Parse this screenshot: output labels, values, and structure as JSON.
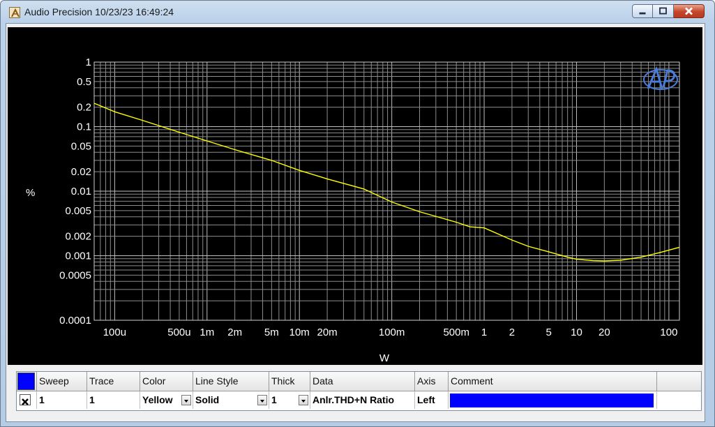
{
  "window": {
    "title": "Audio Precision  10/23/23 16:49:24"
  },
  "chart_data": {
    "type": "line",
    "xscale": "log",
    "yscale": "log",
    "xlabel": "W",
    "ylabel": "%",
    "xlim": [
      6e-05,
      130
    ],
    "ylim": [
      0.0001,
      1
    ],
    "x_ticks": [
      {
        "v": 0.0001,
        "label": "100u"
      },
      {
        "v": 0.0005,
        "label": "500u"
      },
      {
        "v": 0.001,
        "label": "1m"
      },
      {
        "v": 0.002,
        "label": "2m"
      },
      {
        "v": 0.005,
        "label": "5m"
      },
      {
        "v": 0.01,
        "label": "10m"
      },
      {
        "v": 0.02,
        "label": "20m"
      },
      {
        "v": 0.1,
        "label": "100m"
      },
      {
        "v": 0.5,
        "label": "500m"
      },
      {
        "v": 1,
        "label": "1"
      },
      {
        "v": 2,
        "label": "2"
      },
      {
        "v": 5,
        "label": "5"
      },
      {
        "v": 10,
        "label": "10"
      },
      {
        "v": 20,
        "label": "20"
      },
      {
        "v": 100,
        "label": "100"
      }
    ],
    "y_ticks": [
      {
        "v": 1,
        "label": "1"
      },
      {
        "v": 0.5,
        "label": "0.5"
      },
      {
        "v": 0.2,
        "label": "0.2"
      },
      {
        "v": 0.1,
        "label": "0.1"
      },
      {
        "v": 0.05,
        "label": "0.05"
      },
      {
        "v": 0.02,
        "label": "0.02"
      },
      {
        "v": 0.01,
        "label": "0.01"
      },
      {
        "v": 0.005,
        "label": "0.005"
      },
      {
        "v": 0.002,
        "label": "0.002"
      },
      {
        "v": 0.001,
        "label": "0.001"
      },
      {
        "v": 0.0005,
        "label": "0.0005"
      },
      {
        "v": 0.0001,
        "label": "0.0001"
      }
    ],
    "grid": true,
    "series": [
      {
        "color": "#ffff00",
        "x": [
          6e-05,
          0.0001,
          0.0002,
          0.0005,
          0.001,
          0.002,
          0.005,
          0.01,
          0.02,
          0.05,
          0.1,
          0.2,
          0.5,
          0.7,
          1,
          2,
          3,
          5,
          8,
          10,
          15,
          20,
          30,
          50,
          80,
          130
        ],
        "y": [
          0.23,
          0.17,
          0.125,
          0.082,
          0.06,
          0.044,
          0.03,
          0.021,
          0.0155,
          0.0108,
          0.0068,
          0.0048,
          0.0033,
          0.0028,
          0.0027,
          0.00175,
          0.0014,
          0.00115,
          0.00095,
          0.00088,
          0.00084,
          0.00083,
          0.00085,
          0.00095,
          0.00112,
          0.00135
        ]
      }
    ]
  },
  "table": {
    "headers": [
      "Sweep",
      "Trace",
      "Color",
      "Line Style",
      "Thick",
      "Data",
      "Axis",
      "Comment"
    ],
    "row": {
      "sweep": "1",
      "trace": "1",
      "color": "Yellow",
      "line_style": "Solid",
      "thick": "1",
      "data": "Anlr.THD+N Ratio",
      "axis": "Left",
      "comment": ""
    },
    "header_swatch_color": "#0000ff"
  }
}
